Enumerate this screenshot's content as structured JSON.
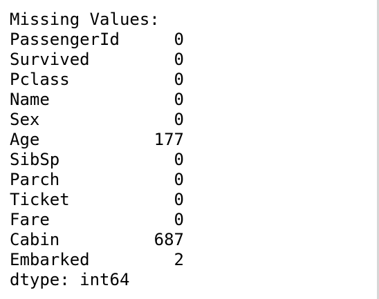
{
  "output": {
    "heading": "Missing Values:",
    "rows": [
      {
        "name": "PassengerId",
        "value": "0"
      },
      {
        "name": "Survived",
        "value": "0"
      },
      {
        "name": "Pclass",
        "value": "0"
      },
      {
        "name": "Name",
        "value": "0"
      },
      {
        "name": "Sex",
        "value": "0"
      },
      {
        "name": "Age",
        "value": "177"
      },
      {
        "name": "SibSp",
        "value": "0"
      },
      {
        "name": "Parch",
        "value": "0"
      },
      {
        "name": "Ticket",
        "value": "0"
      },
      {
        "name": "Fare",
        "value": "0"
      },
      {
        "name": "Cabin",
        "value": "687"
      },
      {
        "name": "Embarked",
        "value": "2"
      }
    ],
    "dtype": "dtype: int64"
  }
}
